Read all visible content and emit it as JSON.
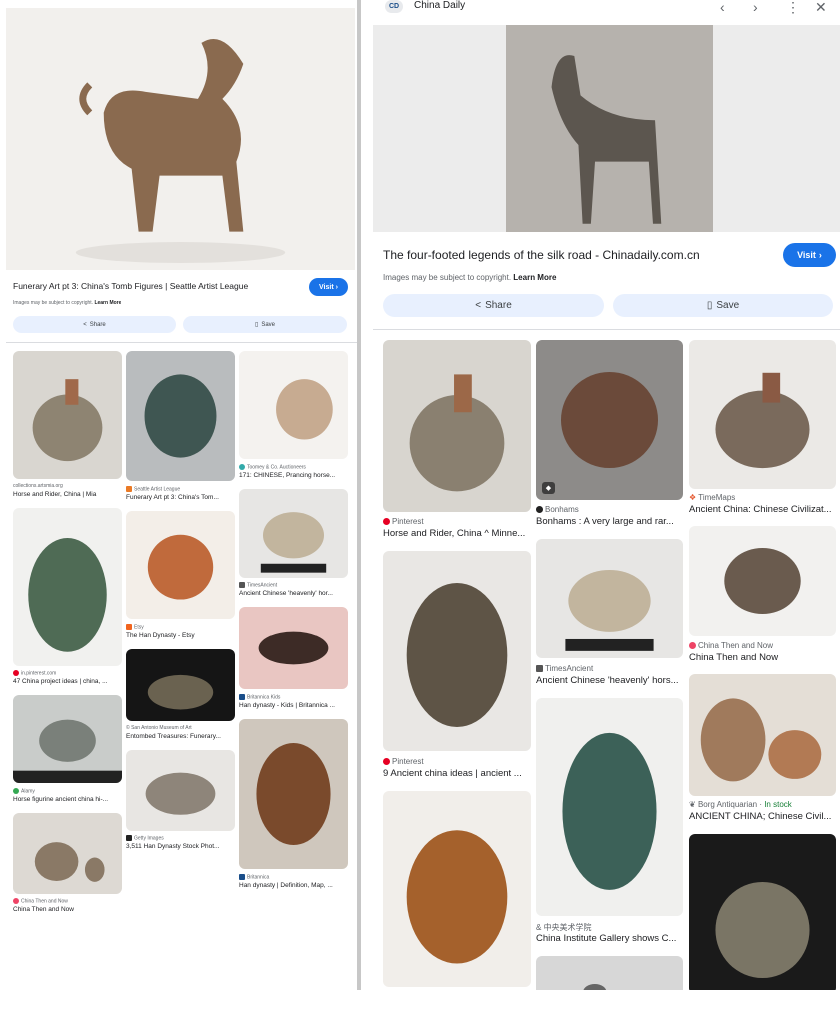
{
  "left_panel": {
    "main_title": "Funerary Art pt 3: China's Tomb Figures | Seattle Artist League",
    "visit_label": "Visit",
    "copyright_text": "Images may be subject to copyright.",
    "learn_more": "Learn More",
    "share_label": "Share",
    "save_label": "Save",
    "grid": [
      {
        "source": "collections.artsmia.org",
        "title": "Horse and Rider, China | Mia"
      },
      {
        "source": "Seattle Artist League",
        "title": "Funerary Art pt 3: China's Tom..."
      },
      {
        "source": "Toomey & Co. Auctioneers",
        "title": "171: CHINESE, Prancing horse..."
      },
      {
        "source": "in.pinterest.com",
        "title": "47 China project ideas | china, ..."
      },
      {
        "source": "Etsy",
        "title": "The Han Dynasty - Etsy"
      },
      {
        "source": "TimesAncient",
        "title": "Ancient Chinese 'heavenly' hor..."
      },
      {
        "source": "Alamy",
        "title": "Horse figurine ancient china hi-..."
      },
      {
        "source": "San Antonio Museum of Art",
        "title": "Entombed Treasures: Funerary..."
      },
      {
        "source": "Britannica Kids",
        "title": "Han dynasty - Kids | Britannica ..."
      },
      {
        "source": "China Then and Now",
        "title": "China Then and Now"
      },
      {
        "source": "Getty Images",
        "title": "3,511 Han Dynasty Stock Phot..."
      },
      {
        "source": "Britannica",
        "title": "Han dynasty | Definition, Map, ..."
      }
    ]
  },
  "right_panel": {
    "site_badge": "CD",
    "site_name": "China Daily",
    "main_title": "The four-footed legends of the silk road - Chinadaily.com.cn",
    "visit_label": "Visit",
    "copyright_text": "Images may be subject to copyright.",
    "learn_more": "Learn More",
    "share_label": "Share",
    "save_label": "Save",
    "grid": [
      {
        "source": "Pinterest",
        "title": "Horse and Rider, China ^ Minne..."
      },
      {
        "source": "Bonhams",
        "title": "Bonhams : A very large and rar..."
      },
      {
        "source": "TimeMaps",
        "title": "Ancient China: Chinese Civilizat..."
      },
      {
        "source": "Pinterest",
        "title": "9 Ancient china ideas | ancient ..."
      },
      {
        "source": "TimesAncient",
        "title": "Ancient Chinese 'heavenly' hors..."
      },
      {
        "source": "China Then and Now",
        "title": "China Then and Now"
      },
      {
        "source": "中央美术学院",
        "title": "China Institute Gallery shows C..."
      },
      {
        "source": "Borg Antiquarian",
        "stock": "In stock",
        "title": "ANCIENT CHINA; Chinese Civil..."
      }
    ]
  },
  "icons": {
    "back": "chevron-left-icon",
    "forward": "chevron-right-icon",
    "more": "more-vert-icon",
    "close": "close-icon",
    "share": "share-icon",
    "save": "bookmark-icon"
  },
  "colors": {
    "accent": "#1a73e8",
    "pill_bg": "#e8f0fe",
    "pinterest": "#e60023"
  }
}
